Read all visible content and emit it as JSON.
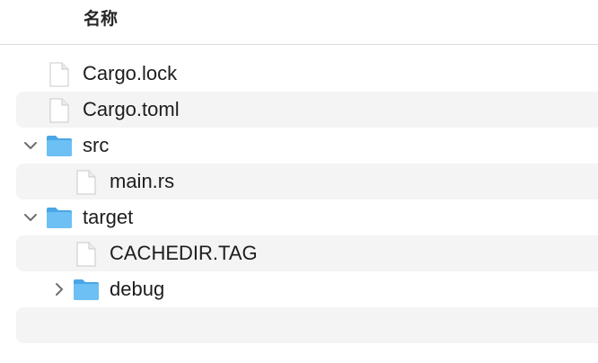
{
  "header": {
    "name_column": "名称"
  },
  "rows": [
    {
      "name": "Cargo.lock",
      "kind": "file",
      "depth": 0,
      "disclosure": "none"
    },
    {
      "name": "Cargo.toml",
      "kind": "file",
      "depth": 0,
      "disclosure": "none"
    },
    {
      "name": "src",
      "kind": "folder",
      "depth": 0,
      "disclosure": "expanded"
    },
    {
      "name": "main.rs",
      "kind": "file",
      "depth": 1,
      "disclosure": "none"
    },
    {
      "name": "target",
      "kind": "folder",
      "depth": 0,
      "disclosure": "expanded"
    },
    {
      "name": "CACHEDIR.TAG",
      "kind": "file",
      "depth": 1,
      "disclosure": "none"
    },
    {
      "name": "debug",
      "kind": "folder",
      "depth": 1,
      "disclosure": "collapsed"
    },
    {
      "name": "",
      "kind": "empty",
      "depth": 0,
      "disclosure": "none"
    }
  ],
  "colors": {
    "folder": "#5fb5ef",
    "folder_tab": "#4aa6e6",
    "alt_row": "#f4f4f5",
    "text": "#1d1d1f"
  },
  "icons": {
    "file": "document-icon",
    "folder": "folder-icon",
    "expanded": "chevron-down-icon",
    "collapsed": "chevron-right-icon"
  }
}
